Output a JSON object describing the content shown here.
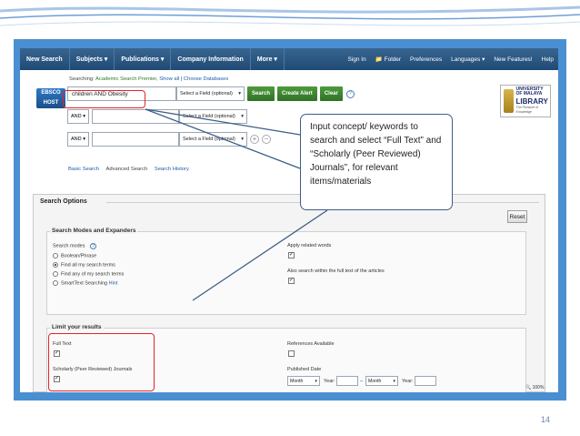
{
  "navbar": {
    "left": [
      "New Search",
      "Subjects ▾",
      "Publications ▾",
      "Company Information",
      "More ▾"
    ],
    "right": [
      "Sign In",
      "📁 Folder",
      "Preferences",
      "Languages ▾",
      "New Features!",
      "Help"
    ]
  },
  "search": {
    "searching_prefix": "Searching:",
    "database": "Academic Search Premier,",
    "show_all": "Show all",
    "choose_databases": "Choose Databases",
    "logo_text": "EBSCO HOST",
    "query": "children AND Obesity",
    "field_placeholder": "Select a Field (optional)",
    "search_button": "Search",
    "create_alert_button": "Create Alert",
    "clear_button": "Clear",
    "help_glyph": "?",
    "bool_value": "AND",
    "plus_glyph": "+",
    "minus_glyph": "−",
    "links": [
      "Basic Search",
      "Advanced Search",
      "Search History"
    ]
  },
  "university": {
    "line1": "UNIVERSITY",
    "line2": "OF MALAYA",
    "line3": "LIBRARY",
    "tagline": "The Pinnacle of Knowledge"
  },
  "options": {
    "title": "Search Options",
    "reset_button": "Reset",
    "modes_section": "Search Modes and Expanders",
    "search_modes_label": "Search modes",
    "modes": [
      "Boolean/Phrase",
      "Find all my search terms",
      "Find any of my search terms",
      "SmartText Searching"
    ],
    "hint_link": "Hint",
    "apply_related": "Apply related words",
    "full_text_expander": "Also search within the full text of the articles",
    "limit_section": "Limit your results",
    "full_text": "Full Text",
    "scholarly": "Scholarly (Peer Reviewed) Journals",
    "references": "References Available",
    "published_date": "Published Date",
    "month_value": "Month",
    "year_label": "Year:",
    "dash": "–",
    "check_glyph": "✓"
  },
  "callout": {
    "text": "Input concept/ keywords to search and select “Full Text” and “Scholarly (Peer Reviewed) Journals”, for relevant items/materials"
  },
  "status": {
    "zoom": "100%"
  },
  "slide": {
    "page_number": "14"
  },
  "colors": {
    "highlight": "#e0262c",
    "frame": "#4a8fd1",
    "navbar": "#2a5782",
    "accent_green": "#3b8530"
  }
}
